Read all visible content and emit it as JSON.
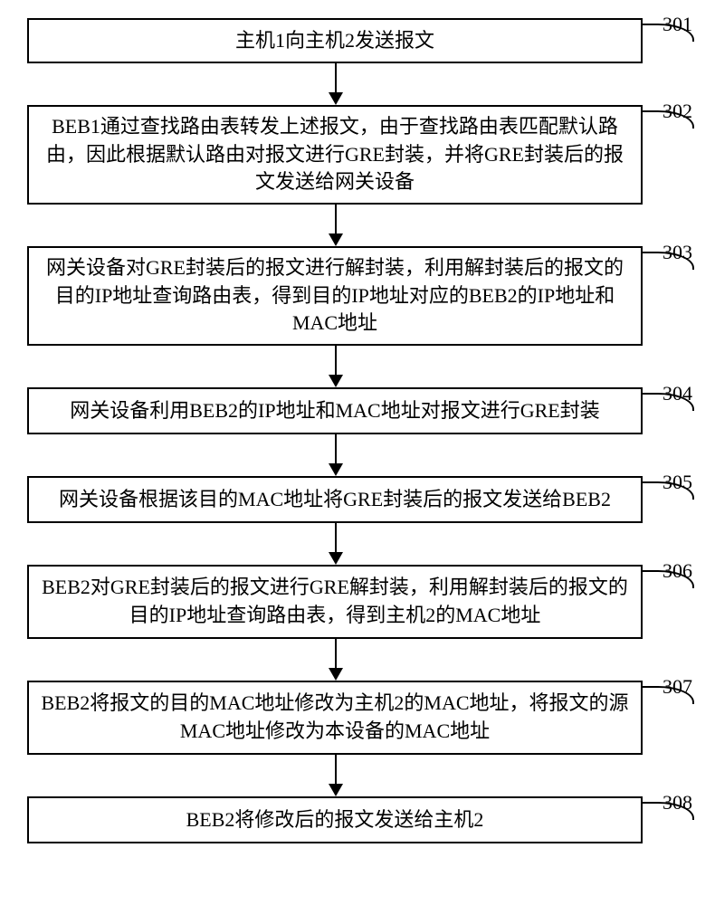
{
  "flow": {
    "steps": [
      {
        "num": "301",
        "text": "主机1向主机2发送报文"
      },
      {
        "num": "302",
        "text": "BEB1通过查找路由表转发上述报文，由于查找路由表匹配默认路由，因此根据默认路由对报文进行GRE封装，并将GRE封装后的报文发送给网关设备"
      },
      {
        "num": "303",
        "text": "网关设备对GRE封装后的报文进行解封装，利用解封装后的报文的目的IP地址查询路由表，得到目的IP地址对应的BEB2的IP地址和MAC地址"
      },
      {
        "num": "304",
        "text": "网关设备利用BEB2的IP地址和MAC地址对报文进行GRE封装"
      },
      {
        "num": "305",
        "text": "网关设备根据该目的MAC地址将GRE封装后的报文发送给BEB2"
      },
      {
        "num": "306",
        "text": "BEB2对GRE封装后的报文进行GRE解封装，利用解封装后的报文的目的IP地址查询路由表，得到主机2的MAC地址"
      },
      {
        "num": "307",
        "text": "BEB2将报文的目的MAC地址修改为主机2的MAC地址，将报文的源MAC地址修改为本设备的MAC地址"
      },
      {
        "num": "308",
        "text": "BEB2将修改后的报文发送给主机2"
      }
    ]
  }
}
